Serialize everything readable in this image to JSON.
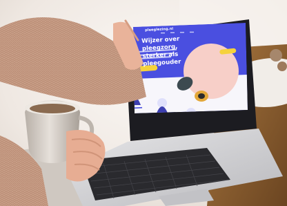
{
  "website": {
    "logo_text": "pleeglezing.nl",
    "headline": "Wijzer over pleegzorg, sterker als pleegouder",
    "hero_cta_label": "",
    "corner_cta_label": ""
  },
  "colors": {
    "site_primary": "#4a4fe0",
    "site_accent": "#f5d23c",
    "sweater": "#c89e87",
    "mug": "#d8d2cc",
    "laptop_body": "#cdcdd0",
    "keyboard": "#2a2a2e",
    "background": "#efe9e4"
  },
  "icons": [
    "laptop-icon",
    "coffee-mug-icon",
    "hand-icon",
    "illustration-woman-icon"
  ]
}
